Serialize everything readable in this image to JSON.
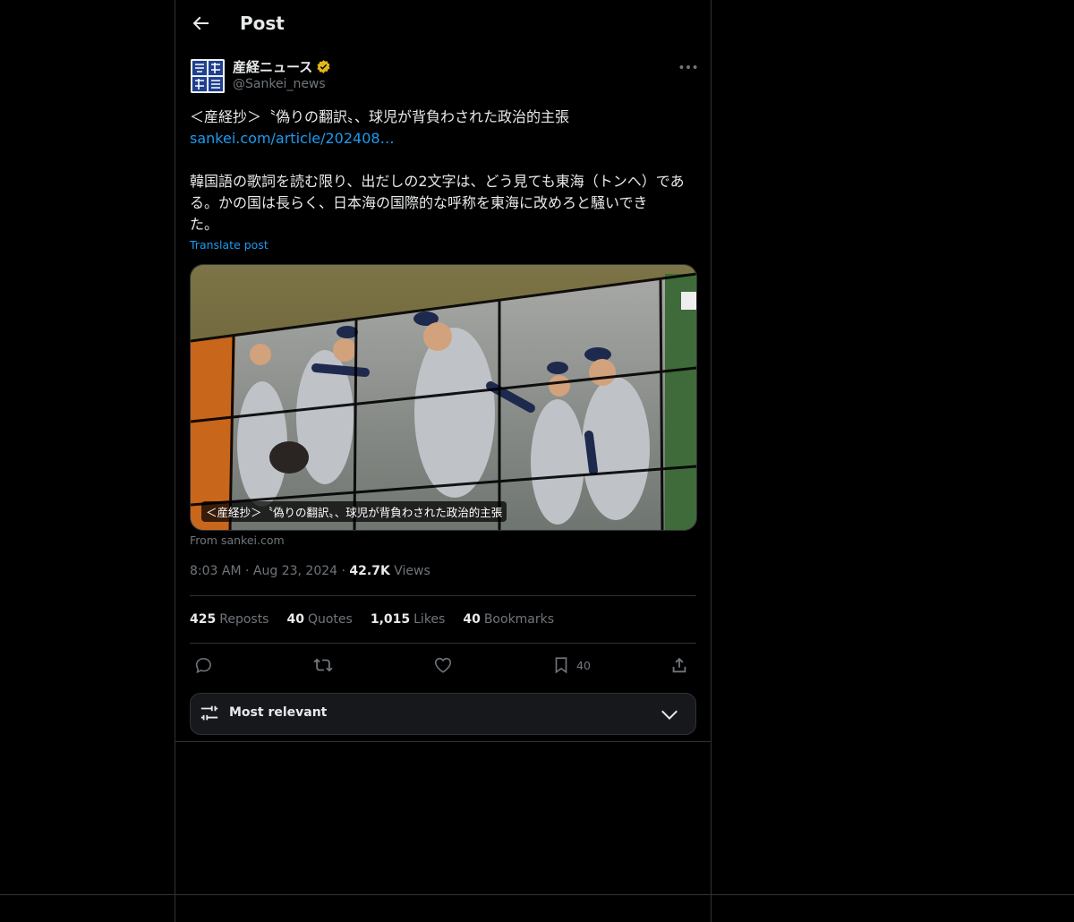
{
  "header": {
    "title": "Post"
  },
  "author": {
    "name": "産経ニュース",
    "handle": "@Sankei_news",
    "avatar_text": "産経新聞"
  },
  "post": {
    "line1": "＜産経抄＞〝偽りの翻訳〟、球児が背負わされた政治的主張",
    "link": "sankei.com/article/202408…",
    "body": "韓国語の歌詞を読む限り、出だしの2文字は、どう見ても東海（トンヘ）である。かの国は長らく、日本海の国際的な呼称を東海に改めろと騒いでき",
    "body_tail": "た。",
    "translate": "Translate post"
  },
  "card": {
    "caption": "＜産経抄＞〝偽りの翻訳〟、球児が背負わされた政治的主張",
    "from": "From sankei.com"
  },
  "meta": {
    "time": "8:03 AM",
    "sep": "·",
    "date": "Aug 23, 2024",
    "views_count": "42.7K",
    "views_label": "Views"
  },
  "stats": [
    {
      "count": "425",
      "label": "Reposts"
    },
    {
      "count": "40",
      "label": "Quotes"
    },
    {
      "count": "1,015",
      "label": "Likes"
    },
    {
      "count": "40",
      "label": "Bookmarks"
    }
  ],
  "actions": {
    "bookmark_count": "40"
  },
  "sort": {
    "label": "Most relevant"
  },
  "colors": {
    "accent": "#1d9bf0",
    "muted": "#71767b",
    "text": "#e7e9ea",
    "border": "#2f3336",
    "verified": "#e2b719"
  }
}
